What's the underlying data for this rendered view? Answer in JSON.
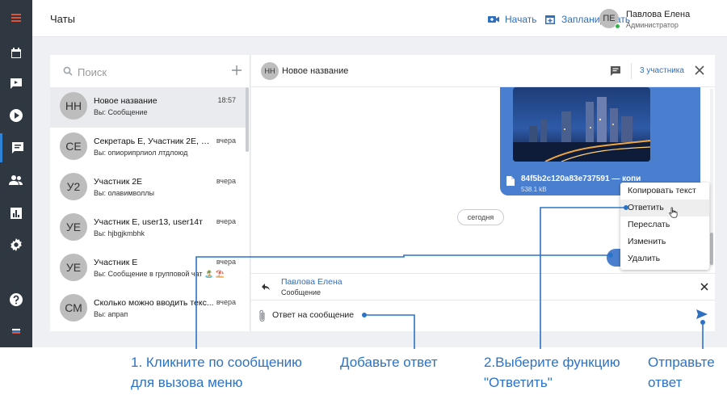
{
  "topbar": {
    "title": "Чаты",
    "start_label": "Начать",
    "schedule_label": "Запланировать",
    "user_initials": "ПЕ",
    "user_name": "Павлова Елена",
    "user_role": "Администратор"
  },
  "colors": {
    "accent": "#2f6fbf",
    "rail": "#2f3740",
    "bubble": "#4a7fcf",
    "annotation": "#2a73c6",
    "online": "#32b34a"
  },
  "rail_icons": [
    "menu-icon",
    "calendar-icon",
    "video-icon",
    "play-icon",
    "chat-icon",
    "people-icon",
    "chart-icon",
    "gear-icon",
    "help-icon",
    "flag-icon"
  ],
  "search": {
    "placeholder": "Поиск"
  },
  "chats": [
    {
      "initials": "НН",
      "name": "Новое название",
      "time": "18:57",
      "preview": "Вы: Сообщение"
    },
    {
      "initials": "СЕ",
      "name": "Секретарь Е, Участник 2Е, Участник ...",
      "time": "вчера",
      "preview": "Вы: опиорипрлиол лтдлоюд"
    },
    {
      "initials": "У2",
      "name": "Участник 2Е",
      "time": "вчера",
      "preview": "Вы: олавимволлы"
    },
    {
      "initials": "УЕ",
      "name": "Участник Е, user13, user14т",
      "time": "вчера",
      "preview": "Вы: hjbgjkmbhk"
    },
    {
      "initials": "УЕ",
      "name": "Участник Е",
      "time": "вчера",
      "preview": "Вы: Сообщение в групповой чат 🏝️ ⛱️"
    },
    {
      "initials": "СМ",
      "name": "Сколько можно вводить текс...",
      "time": "вчера",
      "preview": "Вы: апрап"
    }
  ],
  "chat": {
    "initials": "НН",
    "title": "Новое название",
    "participants": "3 участника",
    "file_name": "84f5b2c120a83e737591 — копи...",
    "file_size": "538.1 kB",
    "date_separator": "сегодня"
  },
  "context_menu": [
    "Копировать текст",
    "Ответить",
    "Переслать",
    "Изменить",
    "Удалить"
  ],
  "reply": {
    "name": "Павлова Елена",
    "text": "Сообщение"
  },
  "composer": {
    "value": "Ответ на сообщение"
  },
  "annotations": {
    "step1_line1": "1. Кликните по сообщению",
    "step1_line2": "для вызова меню",
    "add_reply": "Добавьте ответ",
    "step2_line1": "2.Выберите функцию",
    "step2_line2": "\"Ответить\"",
    "send_line1": "Отправьте",
    "send_line2": "ответ"
  }
}
